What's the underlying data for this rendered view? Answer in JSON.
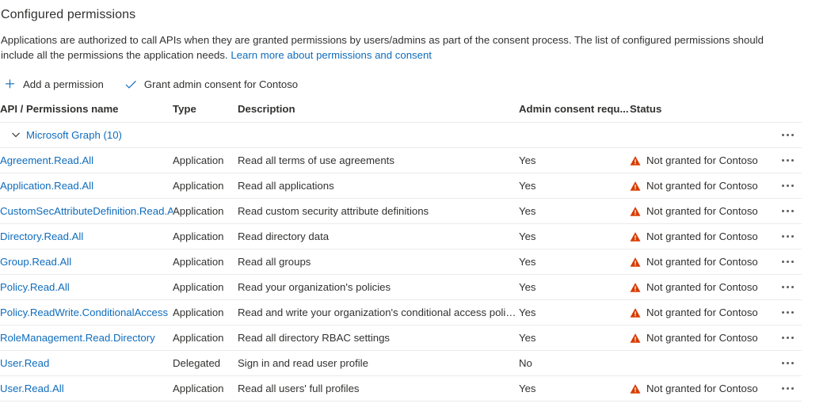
{
  "section": {
    "title": "Configured permissions",
    "description_part1": "Applications are authorized to call APIs when they are granted permissions by users/admins as part of the consent process. The list of configured permissions should include all the permissions the application needs. ",
    "learn_more_link": "Learn more about permissions and consent"
  },
  "commandbar": {
    "add_permission_label": "Add a permission",
    "add_permission_icon": "plus-icon",
    "grant_consent_label": "Grant admin consent for Contoso",
    "grant_consent_icon": "checkmark-icon"
  },
  "table": {
    "headers": {
      "name": "API / Permissions name",
      "type": "Type",
      "description": "Description",
      "admin_consent": "Admin consent requ...",
      "status": "Status"
    },
    "group": {
      "label": "Microsoft Graph (10)",
      "expanded": true,
      "chevron_icon": "chevron-down-icon",
      "menu_icon": "ellipsis-icon"
    },
    "rows": [
      {
        "name": "Agreement.Read.All",
        "type": "Application",
        "description": "Read all terms of use agreements",
        "admin_consent": "Yes",
        "status": "Not granted for Contoso",
        "status_icon": "warning-icon"
      },
      {
        "name": "Application.Read.All",
        "type": "Application",
        "description": "Read all applications",
        "admin_consent": "Yes",
        "status": "Not granted for Contoso",
        "status_icon": "warning-icon"
      },
      {
        "name": "CustomSecAttributeDefinition.Read.All",
        "type": "Application",
        "description": "Read custom security attribute definitions",
        "admin_consent": "Yes",
        "status": "Not granted for Contoso",
        "status_icon": "warning-icon"
      },
      {
        "name": "Directory.Read.All",
        "type": "Application",
        "description": "Read directory data",
        "admin_consent": "Yes",
        "status": "Not granted for Contoso",
        "status_icon": "warning-icon"
      },
      {
        "name": "Group.Read.All",
        "type": "Application",
        "description": "Read all groups",
        "admin_consent": "Yes",
        "status": "Not granted for Contoso",
        "status_icon": "warning-icon"
      },
      {
        "name": "Policy.Read.All",
        "type": "Application",
        "description": "Read your organization's policies",
        "admin_consent": "Yes",
        "status": "Not granted for Contoso",
        "status_icon": "warning-icon"
      },
      {
        "name": "Policy.ReadWrite.ConditionalAccess",
        "type": "Application",
        "description": "Read and write your organization's conditional access policies",
        "admin_consent": "Yes",
        "status": "Not granted for Contoso",
        "status_icon": "warning-icon"
      },
      {
        "name": "RoleManagement.Read.Directory",
        "type": "Application",
        "description": "Read all directory RBAC settings",
        "admin_consent": "Yes",
        "status": "Not granted for Contoso",
        "status_icon": "warning-icon"
      },
      {
        "name": "User.Read",
        "type": "Delegated",
        "description": "Sign in and read user profile",
        "admin_consent": "No",
        "status": "",
        "status_icon": ""
      },
      {
        "name": "User.Read.All",
        "type": "Application",
        "description": "Read all users' full profiles",
        "admin_consent": "Yes",
        "status": "Not granted for Contoso",
        "status_icon": "warning-icon"
      }
    ]
  },
  "colors": {
    "link": "#0f6cbd",
    "warning": "#d83b01",
    "text": "#323130",
    "border": "#edebe9"
  }
}
